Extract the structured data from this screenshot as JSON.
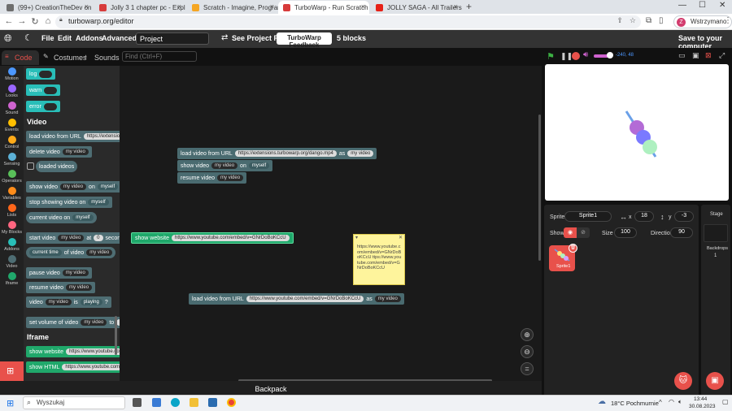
{
  "browser": {
    "tabs": [
      {
        "label": "(99+) CreationTheDev on Game",
        "color": "#6e6e6e"
      },
      {
        "label": "Jolly 3 1 chapter pc - Explore",
        "color": "#d73b3b"
      },
      {
        "label": "Scratch - Imagine, Program, Share",
        "color": "#f5a623"
      },
      {
        "label": "TurboWarp - Run Scratch projects",
        "color": "#d73b3b"
      },
      {
        "label": "JOLLY SAGA - All Trailers / Todos",
        "color": "#e62117"
      }
    ],
    "new_tab": "+",
    "url": "turbowarp.org/editor",
    "profile": "Wstrzymano",
    "profile_initial": "Z"
  },
  "menubar": {
    "file": "File",
    "edit": "Edit",
    "addons": "Addons",
    "advanced": "Advanced",
    "project_title": "Project",
    "see_project_page": "See Project Page",
    "feedback": "TurboWarp Feedback",
    "block_count": "5 blocks",
    "save": "Save to your computer"
  },
  "editor_tabs": {
    "code": "Code",
    "costumes": "Costumes",
    "sounds": "Sounds"
  },
  "find_placeholder": "Find (Ctrl+F)",
  "categories": [
    {
      "label": "Motion",
      "color": "#4c97ff"
    },
    {
      "label": "Looks",
      "color": "#9966ff"
    },
    {
      "label": "Sound",
      "color": "#cf63cf"
    },
    {
      "label": "Events",
      "color": "#ffbf00"
    },
    {
      "label": "Control",
      "color": "#ffab19"
    },
    {
      "label": "Sensing",
      "color": "#5cb1d6"
    },
    {
      "label": "Operators",
      "color": "#59c059"
    },
    {
      "label": "Variables",
      "color": "#ff8c1a"
    },
    {
      "label": "Lists",
      "color": "#ff661a"
    },
    {
      "label": "My Blocks",
      "color": "#ff6680"
    },
    {
      "label": "Addons",
      "color": "#29beb8"
    },
    {
      "label": "Video",
      "color": "#4e6d73"
    },
    {
      "label": "Iframe",
      "color": "#20a86b"
    }
  ],
  "palette": {
    "toggles": [
      "log",
      "warn",
      "error"
    ],
    "video_title": "Video",
    "load_video": "load video from URL",
    "load_video_url": "https://extensions.turbowa",
    "delete_video": "delete video",
    "my_video": "my video",
    "loaded_videos": "loaded videos",
    "show_video": "show video",
    "on": "on",
    "myself": "myself",
    "stop_showing": "stop showing video on",
    "current_video_on": "current video on",
    "start_video": "start video",
    "at": "at",
    "zero": "0",
    "seconds": "seconds",
    "current_time": "current time",
    "of_video": "of video",
    "pause_video": "pause video",
    "resume_video": "resume video",
    "video": "video",
    "is": "is",
    "playing": "playing",
    "q": "?",
    "set_volume": "set volume of video",
    "to": "to",
    "hundred": "100",
    "iframe_title": "Iframe",
    "show_website": "show website",
    "show_website_url": "https://www.youtube.com/watch?",
    "show_html": "show HTML",
    "show_html_url": "https://www.youtube.com/watch?v"
  },
  "canvas": {
    "b1_label": "load video from URL",
    "b1_url": "https://extensions.turbowarp.org/dango.mp4",
    "b1_as": "as",
    "b1_name": "my video",
    "b2_label": "show video",
    "b2_name": "my video",
    "b2_on": "on",
    "b2_target": "myself",
    "b3_label": "resume video",
    "b3_name": "my video",
    "b4_label": "show website",
    "b4_url": "https://www.youtube.com/embed/v=GNrDoBoKCcU",
    "b5_label": "load video from URL",
    "b5_url": "https://www.youtube.com/embed/v=GNrDoBoKCcU",
    "b5_as": "as",
    "b5_name": "my video",
    "note_text": "https://www.youtube.com/embed/v=GNrDoBoKCcU ttps://www.youtube.com/embed/v=GNrDoBoKCcU"
  },
  "backpack": "Backpack",
  "stage": {
    "coords": "-240, 48",
    "sprite_label": "Sprite",
    "sprite_name": "Sprite1",
    "x_label": "x",
    "x_value": "18",
    "y_label": "y",
    "y_value": "-3",
    "show_label": "Show",
    "size_label": "Size",
    "size_value": "100",
    "direction_label": "Direction",
    "direction_value": "90",
    "sprite_thumb": "Sprite1",
    "stage_label": "Stage",
    "backdrops_label": "Backdrops",
    "backdrops_count": "1"
  },
  "taskbar": {
    "search": "Wyszukaj",
    "weather": "18°C  Pochmurnie",
    "time": "13:44",
    "date": "30.08.2023"
  }
}
